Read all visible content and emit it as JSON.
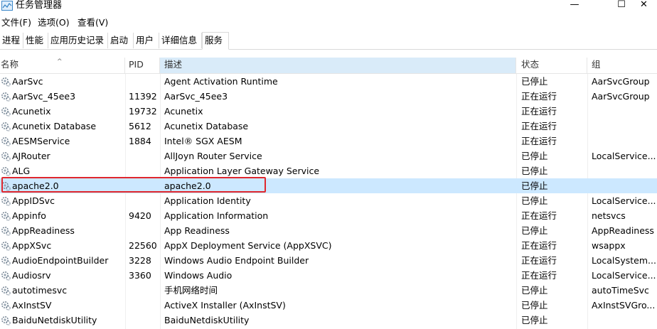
{
  "window": {
    "title": "任务管理器",
    "controls": {
      "minimize": "—",
      "maximize": "☐",
      "close": "✕"
    }
  },
  "menu": {
    "items": [
      "文件(F)",
      "选项(O)",
      "查看(V)"
    ]
  },
  "tabs": {
    "items": [
      "进程",
      "性能",
      "应用历史记录",
      "启动",
      "用户",
      "详细信息",
      "服务"
    ],
    "active_index": 6
  },
  "columns": {
    "name": "名称",
    "pid": "PID",
    "description": "描述",
    "status": "状态",
    "group": "组"
  },
  "services": [
    {
      "name": "AarSvc",
      "pid": "",
      "description": "Agent Activation Runtime",
      "status": "已停止",
      "group": "AarSvcGroup"
    },
    {
      "name": "AarSvc_45ee3",
      "pid": "11392",
      "description": "AarSvc_45ee3",
      "status": "正在运行",
      "group": "AarSvcGroup"
    },
    {
      "name": "Acunetix",
      "pid": "19732",
      "description": "Acunetix",
      "status": "正在运行",
      "group": ""
    },
    {
      "name": "Acunetix Database",
      "pid": "5612",
      "description": "Acunetix Database",
      "status": "正在运行",
      "group": ""
    },
    {
      "name": "AESMService",
      "pid": "1884",
      "description": "Intel® SGX AESM",
      "status": "正在运行",
      "group": ""
    },
    {
      "name": "AJRouter",
      "pid": "",
      "description": "AllJoyn Router Service",
      "status": "已停止",
      "group": "LocalService..."
    },
    {
      "name": "ALG",
      "pid": "",
      "description": "Application Layer Gateway Service",
      "status": "已停止",
      "group": ""
    },
    {
      "name": "apache2.0",
      "pid": "",
      "description": "apache2.0",
      "status": "已停止",
      "group": "",
      "selected": true
    },
    {
      "name": "AppIDSvc",
      "pid": "",
      "description": "Application Identity",
      "status": "已停止",
      "group": "LocalService..."
    },
    {
      "name": "Appinfo",
      "pid": "9420",
      "description": "Application Information",
      "status": "正在运行",
      "group": "netsvcs"
    },
    {
      "name": "AppReadiness",
      "pid": "",
      "description": "App Readiness",
      "status": "已停止",
      "group": "AppReadiness"
    },
    {
      "name": "AppXSvc",
      "pid": "22560",
      "description": "AppX Deployment Service (AppXSVC)",
      "status": "正在运行",
      "group": "wsappx"
    },
    {
      "name": "AudioEndpointBuilder",
      "pid": "3228",
      "description": "Windows Audio Endpoint Builder",
      "status": "正在运行",
      "group": "LocalSystem..."
    },
    {
      "name": "Audiosrv",
      "pid": "3360",
      "description": "Windows Audio",
      "status": "正在运行",
      "group": "LocalService..."
    },
    {
      "name": "autotimesvc",
      "pid": "",
      "description": "手机网络时间",
      "status": "已停止",
      "group": "autoTimeSvc"
    },
    {
      "name": "AxInstSV",
      "pid": "",
      "description": "ActiveX Installer (AxInstSV)",
      "status": "已停止",
      "group": "AxInstSVGro..."
    },
    {
      "name": "BaiduNetdiskUtility",
      "pid": "",
      "description": "BaiduNetdiskUtility",
      "status": "已停止",
      "group": ""
    }
  ]
}
